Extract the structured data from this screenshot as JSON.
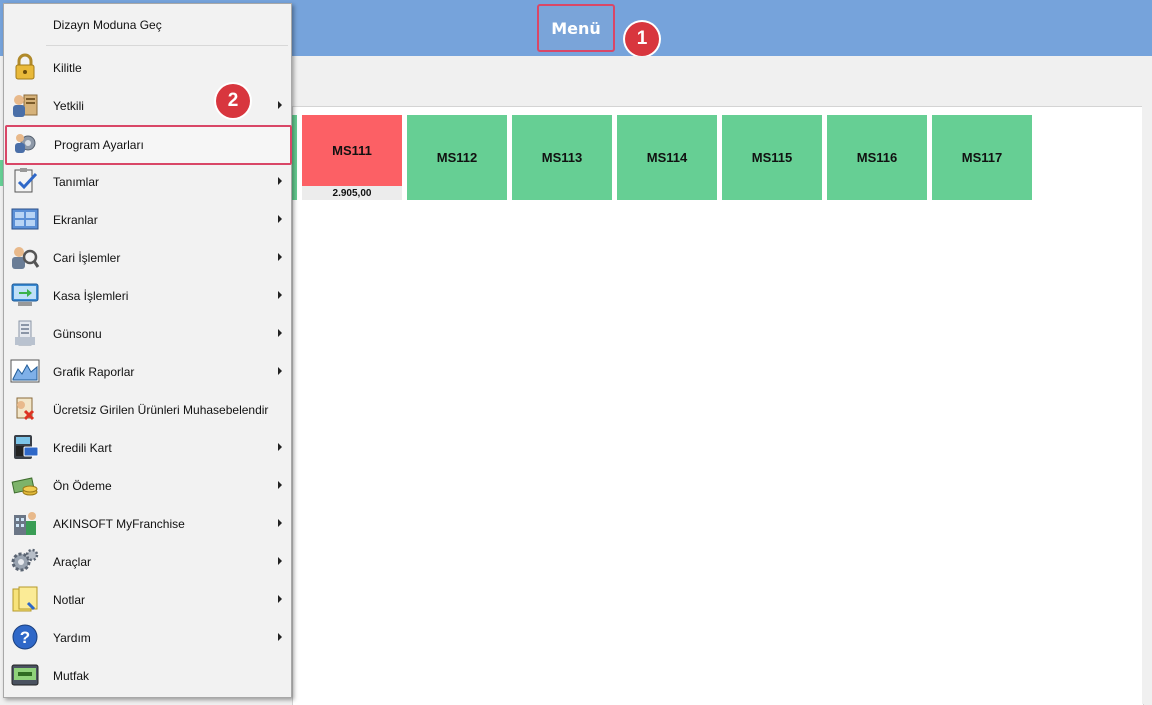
{
  "header": {
    "menu_label": "Menü",
    "badge1": "1",
    "badge2": "2"
  },
  "tables": [
    {
      "name": "MS111",
      "status": "busy",
      "amount": "2.905,00"
    },
    {
      "name": "MS112",
      "status": "free"
    },
    {
      "name": "MS113",
      "status": "free"
    },
    {
      "name": "MS114",
      "status": "free"
    },
    {
      "name": "MS115",
      "status": "free"
    },
    {
      "name": "MS116",
      "status": "free"
    },
    {
      "name": "MS117",
      "status": "free"
    }
  ],
  "colors": {
    "header_bg": "#76a3db",
    "free_table": "#66cf94",
    "busy_table": "#fc6065",
    "highlight": "#d94767",
    "badge": "#d8363e"
  },
  "menu": {
    "items": [
      {
        "label": "Dizayn Moduna Geç",
        "icon": "none",
        "submenu": false
      },
      {
        "label": "Kilitle",
        "icon": "padlock-icon",
        "submenu": false
      },
      {
        "label": "Yetkili",
        "icon": "user-permissions-icon",
        "submenu": true
      },
      {
        "label": "Program Ayarları",
        "icon": "settings-user-icon",
        "submenu": false
      },
      {
        "label": "Tanımlar",
        "icon": "clipboard-check-icon",
        "submenu": true
      },
      {
        "label": "Ekranlar",
        "icon": "screens-icon",
        "submenu": true
      },
      {
        "label": "Cari İşlemler",
        "icon": "accounts-icon",
        "submenu": true
      },
      {
        "label": "Kasa İşlemleri",
        "icon": "cash-monitor-icon",
        "submenu": true
      },
      {
        "label": "Günsonu",
        "icon": "day-end-icon",
        "submenu": true
      },
      {
        "label": "Grafik Raporlar",
        "icon": "chart-icon",
        "submenu": true
      },
      {
        "label": "Ücretsiz Girilen Ürünleri Muhasebelendir",
        "icon": "free-products-icon",
        "submenu": false
      },
      {
        "label": "Kredili Kart",
        "icon": "credit-card-icon",
        "submenu": true
      },
      {
        "label": "Ön Ödeme",
        "icon": "prepayment-icon",
        "submenu": true
      },
      {
        "label": "AKINSOFT MyFranchise",
        "icon": "franchise-icon",
        "submenu": true
      },
      {
        "label": "Araçlar",
        "icon": "tools-gears-icon",
        "submenu": true
      },
      {
        "label": "Notlar",
        "icon": "notes-icon",
        "submenu": true
      },
      {
        "label": "Yardım",
        "icon": "help-icon",
        "submenu": true
      },
      {
        "label": "Mutfak",
        "icon": "kitchen-icon",
        "submenu": false
      }
    ]
  }
}
